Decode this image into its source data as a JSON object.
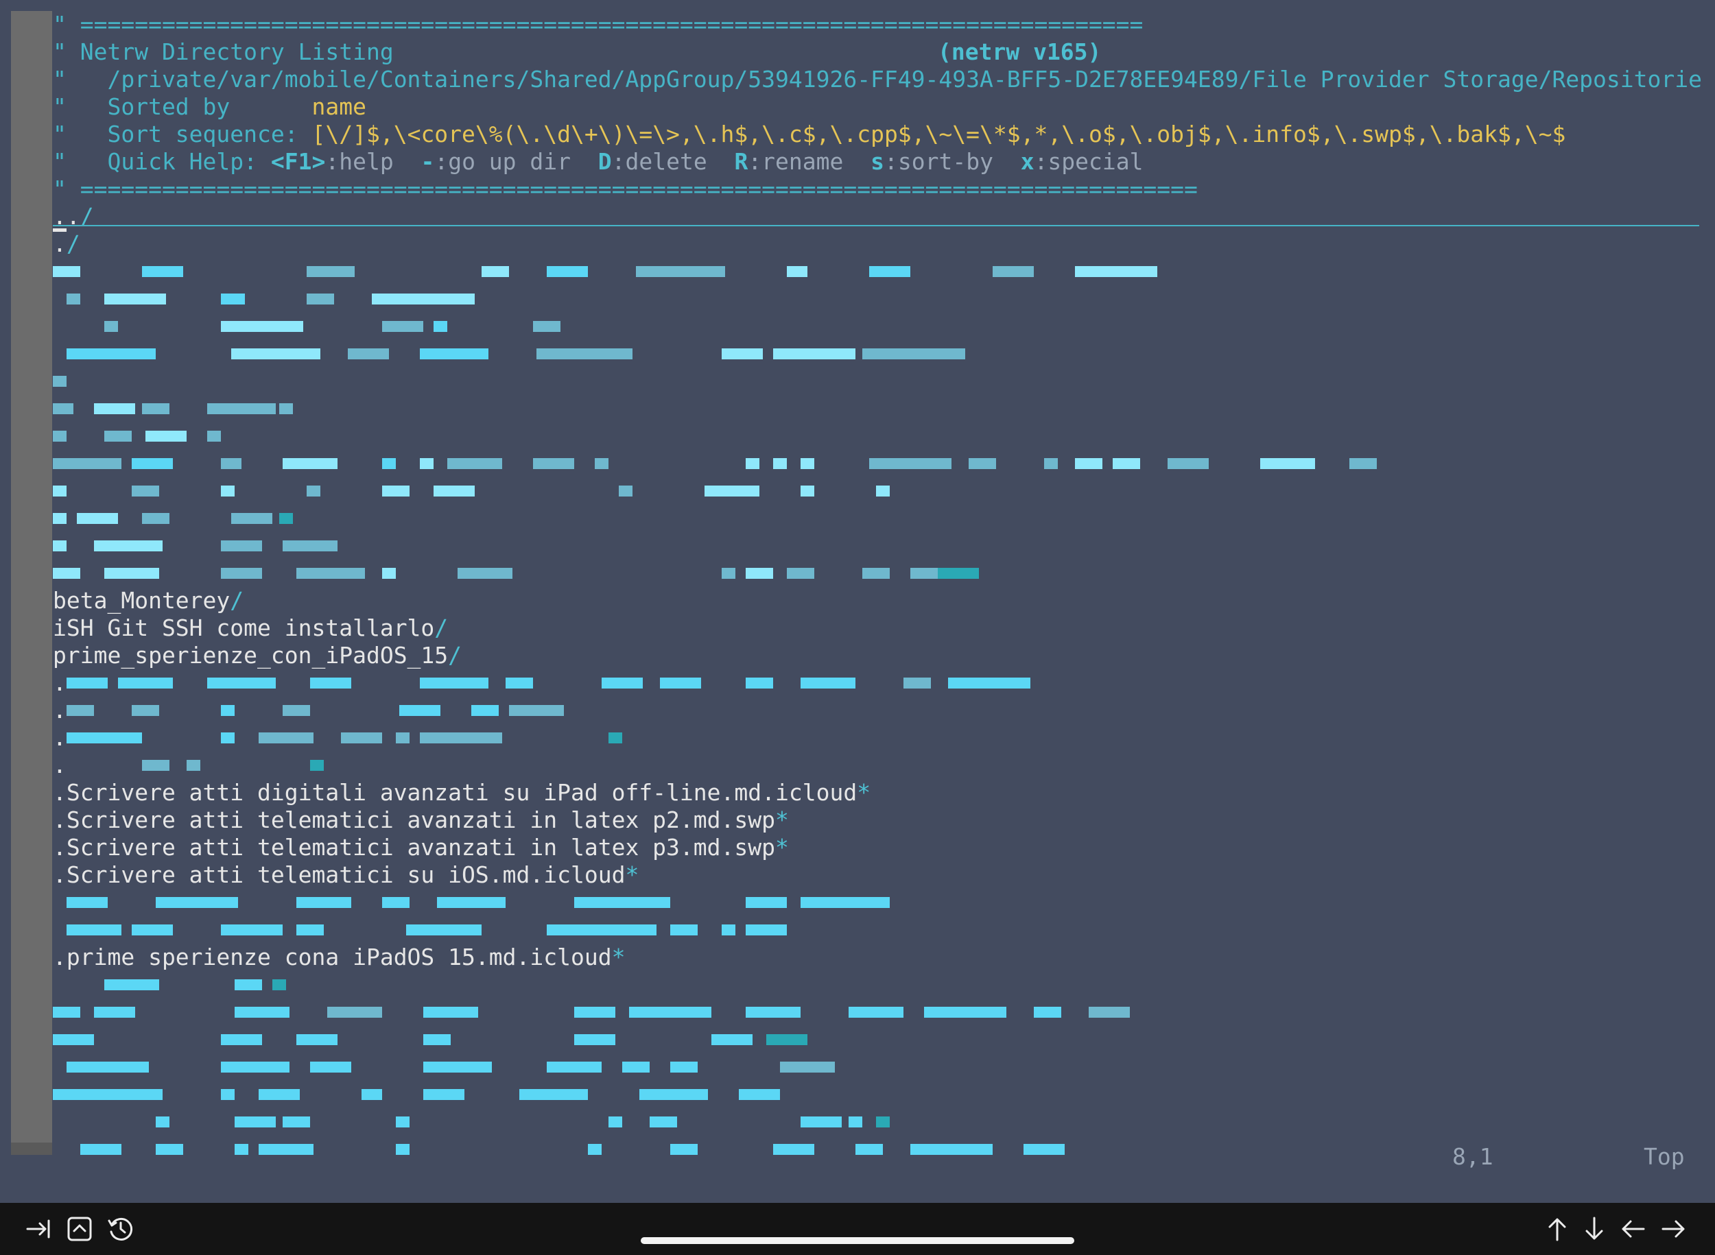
{
  "header": {
    "sep_top": "\" ==============================================================================",
    "title_left": "\" Netrw Directory Listing",
    "title_version": "(netrw v165)",
    "path": "\"   /private/var/mobile/Containers/Shared/AppGroup/53941926-FF49-493A-BFF5-D2E78EE94E89/File Provider Storage/Repositorie",
    "sorted_label": "\"   Sorted by      ",
    "sorted_value": "name",
    "seq_label": "\"   Sort sequence: ",
    "seq_value": "[\\/]$,\\<core\\%(\\.\\d\\+\\)\\=\\>,\\.h$,\\.c$,\\.cpp$,\\~\\=\\*$,*,\\.o$,\\.obj$,\\.info$,\\.swp$,\\.bak$,\\~$",
    "qh_label": "\"   Quick Help: ",
    "qh_k1": "<F1>",
    "qh_d1": ":help  ",
    "qh_k2": "-",
    "qh_d2": ":go up dir  ",
    "qh_k3": "D",
    "qh_d3": ":delete  ",
    "qh_k4": "R",
    "qh_d4": ":rename  ",
    "qh_k5": "s",
    "qh_d5": ":sort-by  ",
    "qh_k6": "x",
    "qh_d6": ":special",
    "sep_bottom": "\" =================================================================================="
  },
  "entries": {
    "up_dir": "../",
    "cur_dir": "./",
    "beta_name": "beta_Monterey",
    "ish_name": "iSH Git SSH come installarlo",
    "prime_name": "prime_sperienze_con_iPadOS_15",
    "dir_suffix": "/",
    "exec_suffix": "*",
    "file1": ".Scrivere atti digitali avanzati su iPad off-line.md.icloud",
    "file2": ".Scrivere atti telematici avanzati in latex p2.md.swp",
    "file3": ".Scrivere atti telematici avanzati in latex p3.md.swp",
    "file4": ".Scrivere atti telematici su iOS.md.icloud",
    "file5": ".prime sperienze cona iPadOS 15.md.icloud",
    "dot": "."
  },
  "status": {
    "position": "8,1",
    "scroll": "Top"
  },
  "toolbar": {
    "tab_icon": "tab-icon",
    "ctrl_icon": "control-key-icon",
    "history_icon": "history-icon",
    "arrows": [
      "arrow-up-icon",
      "arrow-down-icon",
      "arrow-left-icon",
      "arrow-right-icon"
    ]
  },
  "colors": {
    "background": "#434b5f",
    "comment": "#46b4c6",
    "highlight": "#e5c455",
    "directory_slash": "#4ec0d2",
    "pixelated_blocks": [
      "#5bd7f5",
      "#8fe8fb",
      "#6fb8ce",
      "#2aa9b5"
    ]
  }
}
